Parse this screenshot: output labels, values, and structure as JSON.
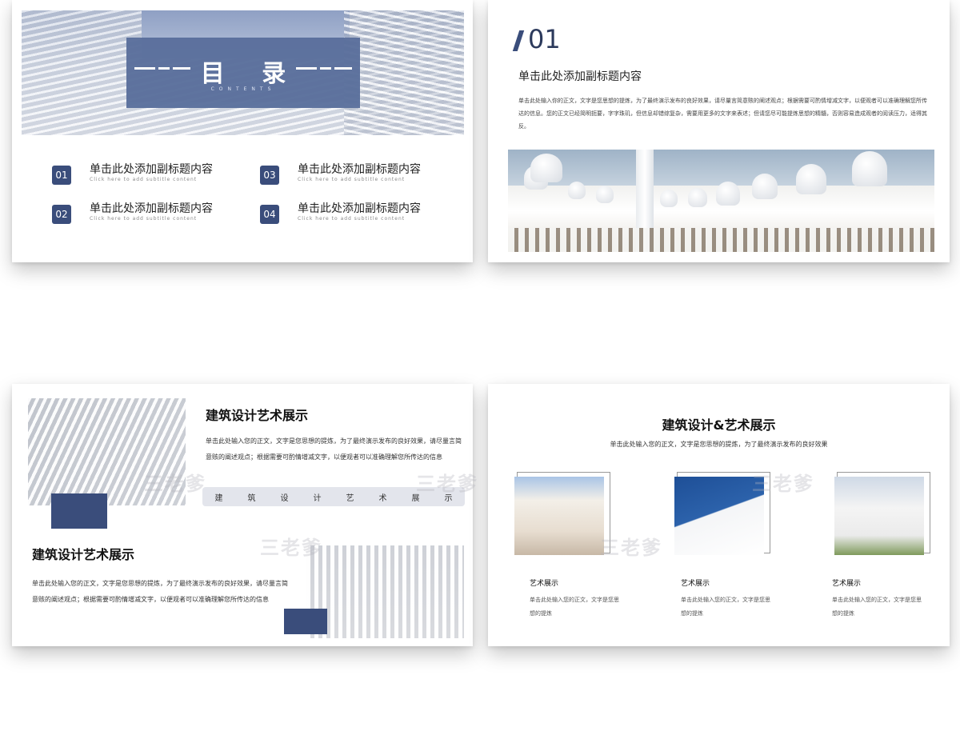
{
  "slide1": {
    "title": "目 录",
    "subtitle": "CONTENTS",
    "items": [
      {
        "num": "01",
        "title": "单击此处添加副标题内容",
        "sub": "Click here to add subtitle content"
      },
      {
        "num": "02",
        "title": "单击此处添加副标题内容",
        "sub": "Click here to add subtitle content"
      },
      {
        "num": "03",
        "title": "单击此处添加副标题内容",
        "sub": "Click here to add subtitle content"
      },
      {
        "num": "04",
        "title": "单击此处添加副标题内容",
        "sub": "Click here to add subtitle content"
      }
    ]
  },
  "slide2": {
    "number": "01",
    "subtitle": "单击此处添加副标题内容",
    "body": "单击此处输入你的正文，文字是您思想的提炼，为了最终演示发布的良好效果，请尽量言简意赅的阐述观点；根据需要可酌情增减文字，以便观者可以准确理解您所传达的信息。您的正文已经简明扼要，字字珠玑，但信息却错综复杂，需要用更多的文字来表述；但请您尽可能提炼思想的精髓，否则容易造成观者的阅读压力，适得其反。"
  },
  "slide3": {
    "heading1": "建筑设计艺术展示",
    "body1": "单击此处输入您的正文，文字是您思想的提炼，为了最终演示发布的良好效果，请尽量言简意赅的阐述观点；根据需要可酌情增减文字，以便观者可以准确理解您所传达的信息",
    "bar_chars": [
      "建",
      "筑",
      "设",
      "计",
      "艺",
      "术",
      "展",
      "示"
    ],
    "heading2": "建筑设计艺术展示",
    "body2": "单击此处输入您的正文，文字是您思想的提炼，为了最终演示发布的良好效果，请尽量言简意赅的阐述观点；根据需要可酌情增减文字，以便观者可以准确理解您所传达的信息"
  },
  "slide4": {
    "title": "建筑设计&艺术展示",
    "subtitle": "单击此处输入您的正文，文字是您思想的提炼，为了最终演示发布的良好效果",
    "cards": [
      {
        "heading": "艺术展示",
        "body": "单击此处输入您的正文，文字是您思想的提炼"
      },
      {
        "heading": "艺术展示",
        "body": "单击此处输入您的正文，文字是您思想的提炼"
      },
      {
        "heading": "艺术展示",
        "body": "单击此处输入您的正文，文字是您思想的提炼"
      }
    ]
  },
  "watermark": "三老爹",
  "colors": {
    "navy": "#3a4d7b",
    "overlay": "#5a6f9c"
  }
}
